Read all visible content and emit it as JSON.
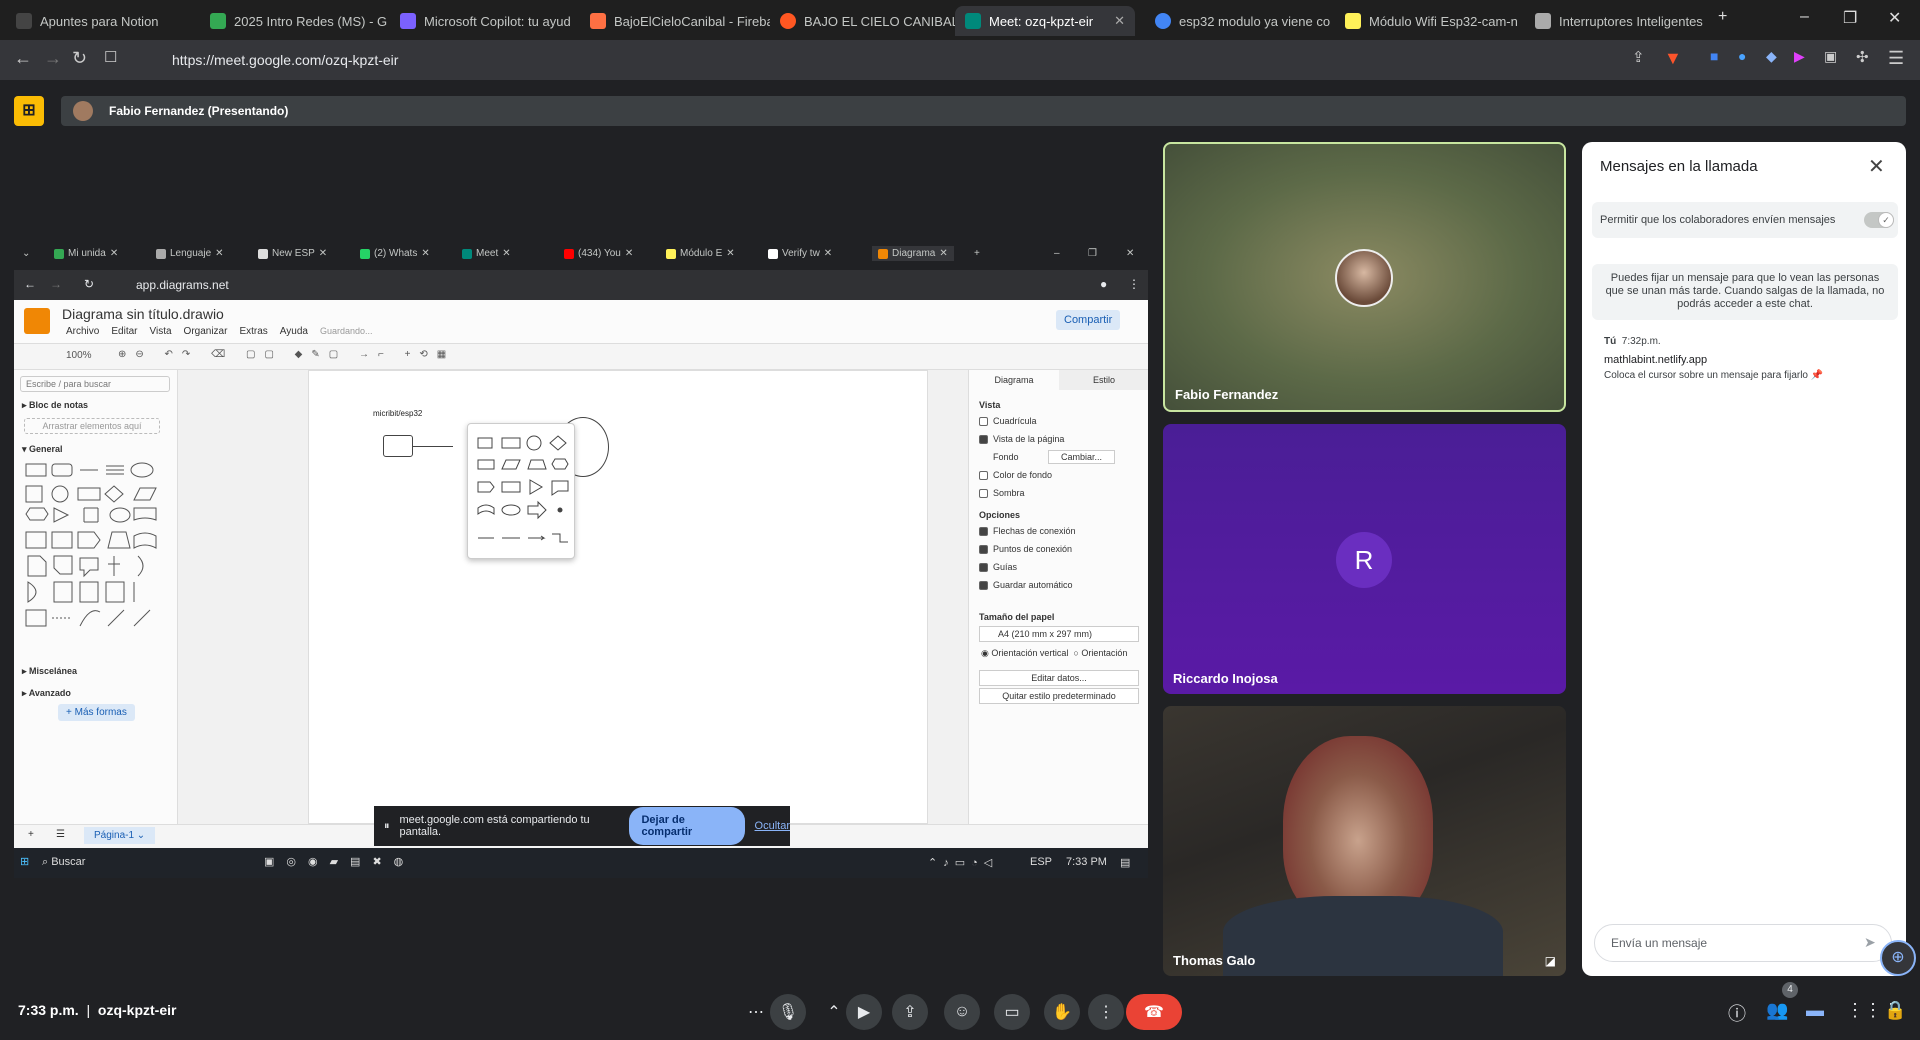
{
  "browser": {
    "tabs": [
      {
        "label": "Apuntes para Notion",
        "color": "#444"
      },
      {
        "label": "2025 Intro Redes (MS) - G",
        "color": "#34a853"
      },
      {
        "label": "Microsoft Copilot: tu ayud",
        "color": "#7b61ff"
      },
      {
        "label": "BajoElCieloCanibal - Fireba",
        "color": "#ff7043"
      },
      {
        "label": "BAJO EL CIELO CANIBAL",
        "color": "#ff5722"
      },
      {
        "label": "Meet: ozq-kpzt-eir",
        "color": "#00897b"
      },
      {
        "label": "esp32 modulo ya viene co",
        "color": "#4285f4"
      },
      {
        "label": "Módulo Wifi Esp32-cam-n",
        "color": "#fff159"
      },
      {
        "label": "Interruptores Inteligentes",
        "color": "#aaa"
      }
    ],
    "url": "https://meet.google.com/ozq-kpzt-eir"
  },
  "presenting": {
    "label": "Fabio Fernandez (Presentando)"
  },
  "shared_screen": {
    "inner_tabs": [
      "Mi unida",
      "Lenguaje",
      "New ESP",
      "(2) Whats",
      "Meet",
      "(434) You",
      "Módulo E",
      "Verify tw",
      "Diagrama"
    ],
    "url": "app.diagrams.net",
    "title": "Diagrama sin título.drawio",
    "menus": [
      "Archivo",
      "Editar",
      "Vista",
      "Organizar",
      "Extras",
      "Ayuda"
    ],
    "saving": "Guardando...",
    "share": "Compartir",
    "zoom": "100%",
    "search_placeholder": "Escribe / para buscar",
    "notepad": "Bloc de notas",
    "drag_here": "Arrastrar elementos aquí",
    "general": "General",
    "misc": "Miscelánea",
    "advanced": "Avanzado",
    "more_shapes": "+ Más formas",
    "canvas_label": "micribit/esp32",
    "fmt_tabs": [
      "Diagrama",
      "Estilo"
    ],
    "view_header": "Vista",
    "view_opts": [
      {
        "label": "Cuadrícula",
        "on": false
      },
      {
        "label": "Vista de la página",
        "on": true
      }
    ],
    "background": "Fondo",
    "change": "Cambiar...",
    "view_opts2": [
      {
        "label": "Color de fondo",
        "on": false
      },
      {
        "label": "Sombra",
        "on": false
      }
    ],
    "options_header": "Opciones",
    "options": [
      {
        "label": "Flechas de conexión",
        "on": true
      },
      {
        "label": "Puntos de conexión",
        "on": true
      },
      {
        "label": "Guías",
        "on": true
      },
      {
        "label": "Guardar automático",
        "on": true
      }
    ],
    "paper_header": "Tamaño del papel",
    "paper": "A4 (210 mm x 297 mm)",
    "orient_v": "Orientación vertical",
    "orient_h": "Orientación",
    "edit_data": "Editar datos...",
    "remove_style": "Quitar estilo predeterminado",
    "page_tab": "Página-1",
    "taskbar_search": "Buscar",
    "lang": "ESP",
    "clock": "7:33 PM",
    "share_note": "meet.google.com está compartiendo tu pantalla.",
    "stop_share": "Dejar de compartir",
    "hide": "Ocultar"
  },
  "participants": [
    {
      "name": "Fabio Fernandez"
    },
    {
      "name": "Riccardo Inojosa",
      "initial": "R"
    },
    {
      "name": "Thomas Galo"
    }
  ],
  "chat": {
    "title": "Mensajes en la llamada",
    "toggle_label": "Permitir que los colaboradores envíen mensajes",
    "info": "Puedes fijar un mensaje para que lo vean las personas que se unan más tarde. Cuando salgas de la llamada, no podrás acceder a este chat.",
    "sender": "Tú",
    "time": "7:32p.m.",
    "message": "mathlabint.netlify.app",
    "hint": "Coloca el cursor sobre un mensaje para fijarlo",
    "input_placeholder": "Envía un mensaje"
  },
  "footer": {
    "time": "7:33 p.m.",
    "separator": "|",
    "code": "ozq-kpzt-eir",
    "people_count": "4"
  },
  "colors": {
    "end_call": "#ea4335",
    "accent": "#8ab4f8"
  }
}
